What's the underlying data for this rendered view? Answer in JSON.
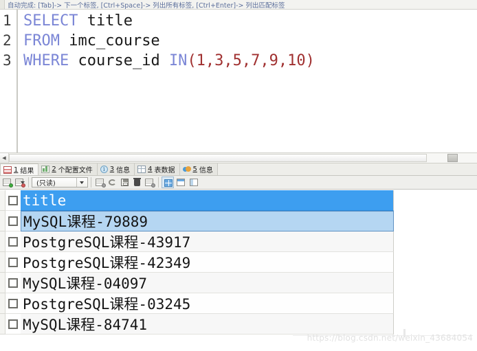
{
  "hint_bar": {
    "text": "自动完成: [Tab]-> 下一个标签, [Ctrl+Space]-> 列出所有标签, [Ctrl+Enter]-> 列出匹配标签"
  },
  "editor": {
    "line_numbers": [
      "1",
      "2",
      "3"
    ],
    "lines": [
      {
        "keyword": "SELECT",
        "rest": " title"
      },
      {
        "keyword": "FROM",
        "rest": " imc_course"
      },
      {
        "keyword": "WHERE",
        "rest": " course_id ",
        "keyword2": "IN",
        "args": "(1,3,5,7,9,10)"
      }
    ],
    "full_sql": "SELECT title\nFROM imc_course\nWHERE course_id IN (1,3,5,7,9,10)"
  },
  "result_tabs": [
    {
      "num": "1",
      "label": "结果",
      "icon": "grid-results-icon",
      "active": true
    },
    {
      "num": "2",
      "label": "个配置文件",
      "icon": "profile-icon",
      "active": false
    },
    {
      "num": "3",
      "label": "信息",
      "icon": "info-icon",
      "active": false
    },
    {
      "num": "4",
      "label": "表数据",
      "icon": "table-data-icon",
      "active": false
    },
    {
      "num": "5",
      "label": "信息",
      "icon": "chart-info-icon",
      "active": false
    }
  ],
  "grid_toolbar": {
    "mode_dropdown_value": "(只读)",
    "buttons": [
      {
        "name": "add-record-button",
        "icon": "grid-plus-green-icon"
      },
      {
        "name": "delete-record-button",
        "icon": "grid-minus-red-icon"
      },
      {
        "name": "refresh-button",
        "icon": "grid-refresh-icon"
      },
      {
        "name": "revert-button",
        "icon": "undo-arrow-icon"
      },
      {
        "name": "save-button",
        "icon": "floppy-save-icon"
      },
      {
        "name": "delete-row-button",
        "icon": "trash-icon"
      },
      {
        "name": "grid-options-button",
        "icon": "grid-search-icon"
      },
      {
        "name": "grid-view-button",
        "icon": "grid-view-icon"
      },
      {
        "name": "form-view-button",
        "icon": "form-view-icon"
      },
      {
        "name": "text-view-button",
        "icon": "text-view-icon"
      }
    ]
  },
  "result_grid": {
    "column_header": "title",
    "rows": [
      {
        "value": "MySQL课程-79889",
        "selected": true
      },
      {
        "value": "PostgreSQL课程-43917",
        "selected": false
      },
      {
        "value": "PostgreSQL课程-42349",
        "selected": false
      },
      {
        "value": "MySQL课程-04097",
        "selected": false
      },
      {
        "value": "PostgreSQL课程-03245",
        "selected": false
      },
      {
        "value": "MySQL课程-84741",
        "selected": false
      }
    ]
  },
  "watermark": {
    "text": "https://blog.csdn.net/weixin_43684054"
  },
  "colors": {
    "header_blue": "#3d9ef0",
    "selected_row_blue": "#b5d6f2",
    "keyword_purple": "#7b86d6",
    "literal_red": "#a03030",
    "hint_text_blue": "#5a6d9a"
  }
}
